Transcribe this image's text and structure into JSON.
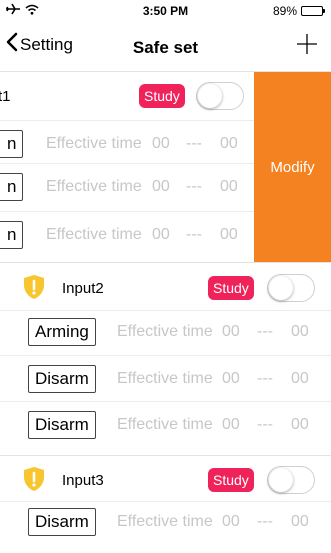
{
  "status": {
    "time": "3:50 PM",
    "battery": "89%"
  },
  "nav": {
    "back_label": "Setting",
    "title": "Safe set"
  },
  "colors": {
    "study": "#f0225a",
    "modify": "#f58220",
    "shield": "#f7c52e"
  },
  "modify_label": "Modify",
  "sections": [
    {
      "name": "t1",
      "study": "Study",
      "rows": [
        {
          "mode": "n",
          "label": "Effective time",
          "start": "00",
          "dash": "---",
          "end": "00"
        },
        {
          "mode": "n",
          "label": "Effective time",
          "start": "00",
          "dash": "---",
          "end": "00"
        },
        {
          "mode": "n",
          "label": "Effective time",
          "start": "00",
          "dash": "---",
          "end": "00"
        }
      ]
    },
    {
      "name": "Input2",
      "study": "Study",
      "rows": [
        {
          "mode": "Arming",
          "label": "Effective time",
          "start": "00",
          "dash": "---",
          "end": "00"
        },
        {
          "mode": "Disarm",
          "label": "Effective time",
          "start": "00",
          "dash": "---",
          "end": "00"
        },
        {
          "mode": "Disarm",
          "label": "Effective time",
          "start": "00",
          "dash": "---",
          "end": "00"
        }
      ]
    },
    {
      "name": "Input3",
      "study": "Study",
      "rows": [
        {
          "mode": "Disarm",
          "label": "Effective time",
          "start": "00",
          "dash": "---",
          "end": "00"
        }
      ]
    }
  ]
}
